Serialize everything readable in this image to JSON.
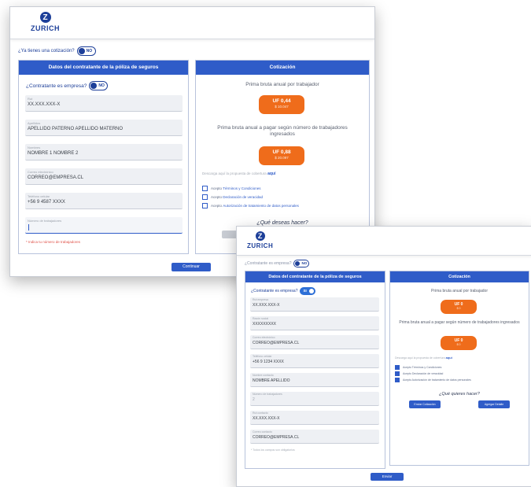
{
  "brand": {
    "logo_letter": "Z",
    "name": "ZURICH"
  },
  "screen1": {
    "have_quote_label": "¿Ya tienes una cotización?",
    "have_quote_toggle": "NO",
    "contractor_panel_title": "Datos del contratante de la póliza de seguros",
    "is_company_label": "¿Contratante es empresa?",
    "is_company_toggle": "NO",
    "fields": [
      {
        "label": "Rut",
        "value": "XX.XXX.XXX-X"
      },
      {
        "label": "Apellidos",
        "value": "APELLIDO PATERNO APELLIDO MATERNO"
      },
      {
        "label": "Nombres",
        "value": "NOMBRE 1 NOMBRE 2"
      },
      {
        "label": "Correo electrónico",
        "value": "CORREO@EMPRESA.CL"
      },
      {
        "label": "Teléfono celular",
        "value": "+56 9 4587 XXXX"
      },
      {
        "label": "Número de trabajadores",
        "value": ""
      }
    ],
    "error_text": "* Indica tu número de trabajadores",
    "quote_panel_title": "Cotización",
    "premium_per_worker_label": "Prima bruta anual por trabajador",
    "premium_per_worker_uf": "UF 0,44",
    "premium_per_worker_clp": "$ 10.047",
    "premium_total_label": "Prima bruta anual a pagar según número de trabajadores ingresados",
    "premium_total_uf": "UF 0,88",
    "premium_total_clp": "$ 20.097",
    "download_hint": "Descarga aquí la propuesta de cobertura",
    "download_link": "aquí",
    "checks": [
      {
        "text": "Acepto",
        "link": "Términos y Condiciones"
      },
      {
        "text": "Acepto",
        "link": "Declaración de veracidad"
      },
      {
        "text": "Acepto",
        "link": "Autorización de tratamiento de datos personales"
      }
    ],
    "what_to_do": "¿Qué deseas hacer?",
    "next_button": "Continuar"
  },
  "screen2": {
    "have_quote_label": "¿Contratante es empresa?",
    "have_quote_toggle": "NO",
    "contractor_panel_title": "Datos del contratante de la póliza de seguros",
    "is_company_label": "¿Contratante es empresa?",
    "is_company_toggle": "SI",
    "fields": [
      {
        "label": "Rut empresa",
        "value": "XX.XXX.XXX-X"
      },
      {
        "label": "Razón social",
        "value": "XXXXXXXXX"
      },
      {
        "label": "Correo electrónico",
        "value": "CORREO@EMPRESA.CL"
      },
      {
        "label": "Teléfono celular",
        "value": "+56 9 1234 XXXX"
      },
      {
        "label": "Nombre contacto",
        "value": "NOMBRE APELLIDO"
      },
      {
        "label": "Número de trabajadores",
        "value": "2"
      },
      {
        "label": "Rut contacto",
        "value": "XX.XXX.XXX-X"
      },
      {
        "label": "Correo contacto",
        "value": "CORREO@EMPRESA.CL"
      }
    ],
    "bottom_hint": "* Todos los campos son obligatorios",
    "quote_panel_title": "Cotización",
    "premium_per_worker_label": "Prima bruta anual por trabajador",
    "premium_per_worker_uf": "UF 0",
    "premium_per_worker_clp": "$ 0",
    "premium_total_label": "Prima bruta anual a pagar según número de trabajadores ingresados",
    "premium_total_uf": "UF 0",
    "premium_total_clp": "$ 0",
    "download_hint": "Descarga aquí la propuesta de cobertura",
    "download_link": "aquí",
    "checks": [
      {
        "text": "Acepto Términos y Condiciones"
      },
      {
        "text": "Acepto Declaración de veracidad"
      },
      {
        "text": "Acepto Autorización de tratamiento de datos personales"
      }
    ],
    "what_to_do": "¿Qué quieres hacer?",
    "left_action": "Enviar Cotización",
    "right_action": "Agregar Detalle",
    "next_button": "Enviar"
  }
}
